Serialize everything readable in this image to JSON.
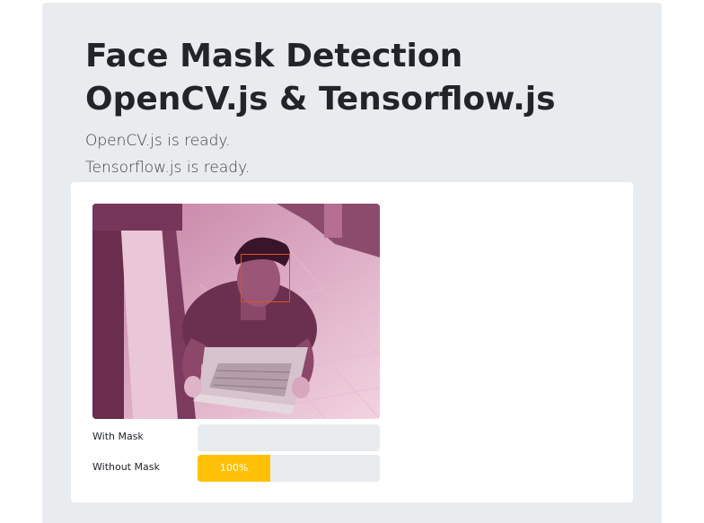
{
  "header": {
    "title": "Face Mask Detection OpenCV.js & Tensorflow.js",
    "opencv_status": "OpenCV.js is ready.",
    "tensorflow_status": "Tensorflow.js is ready."
  },
  "predictions": [
    {
      "label": "With Mask",
      "value": 0,
      "value_text": "",
      "color": "#ffc107"
    },
    {
      "label": "Without Mask",
      "value": 0.4,
      "value_text": "100%",
      "color": "#ffc107"
    }
  ],
  "detection": {
    "box_color": "#e2511e"
  }
}
